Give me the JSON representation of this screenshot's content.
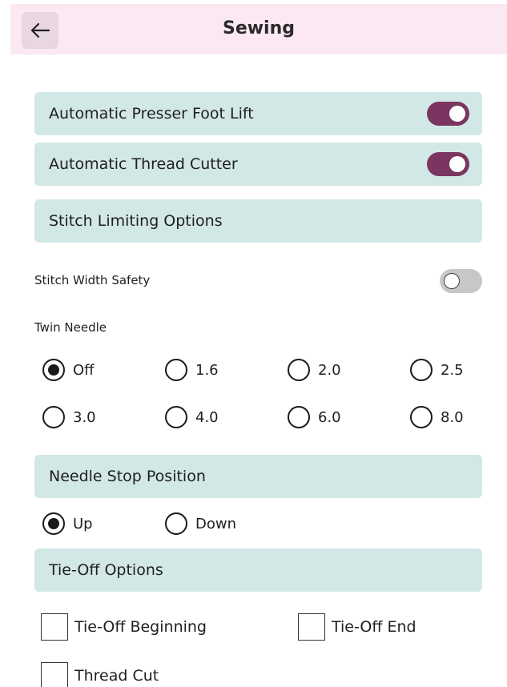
{
  "header": {
    "title": "Sewing",
    "back_icon": "arrow-left-icon"
  },
  "toggles": {
    "presser_foot": {
      "label": "Automatic Presser Foot Lift",
      "on": true
    },
    "thread_cutter": {
      "label": "Automatic Thread Cutter",
      "on": true
    },
    "stitch_width_safety": {
      "label": "Stitch Width Safety",
      "on": false
    }
  },
  "sections": {
    "stitch_limiting": "Stitch Limiting Options",
    "needle_stop": "Needle Stop Position",
    "tie_off": "Tie-Off Options"
  },
  "twin_needle": {
    "label": "Twin Needle",
    "options": [
      "Off",
      "1.6",
      "2.0",
      "2.5",
      "3.0",
      "4.0",
      "6.0",
      "8.0"
    ],
    "selected": "Off"
  },
  "needle_stop": {
    "options": [
      "Up",
      "Down"
    ],
    "selected": "Up"
  },
  "tie_off": {
    "beginning": {
      "label": "Tie-Off Beginning",
      "checked": false
    },
    "end": {
      "label": "Tie-Off End",
      "checked": false
    },
    "thread_cut": {
      "label": "Thread Cut",
      "checked": false
    }
  },
  "colors": {
    "accent": "#7a3560",
    "header_bg": "#fbe8f3",
    "panel_bg": "#d2e8e6",
    "toggle_off": "#c7c7c7"
  }
}
